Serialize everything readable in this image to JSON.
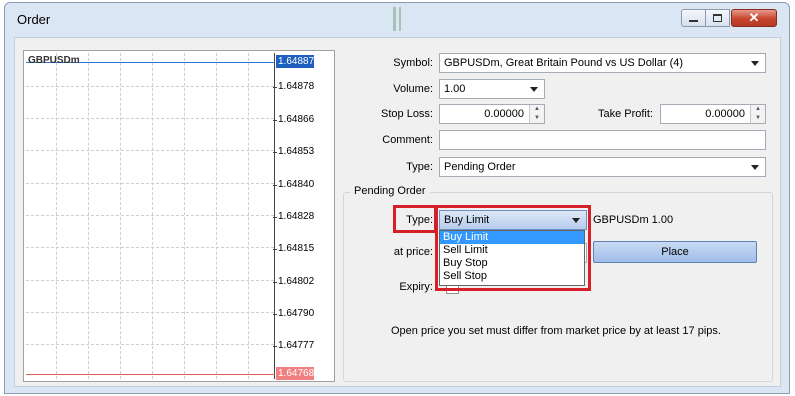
{
  "window": {
    "title": "Order",
    "close_glyph": "✕"
  },
  "chart": {
    "symbol": "GBPUSDm",
    "ask_price": "1.64887",
    "bid_price": "1.64768",
    "price_ticks": [
      "1.64878",
      "1.64866",
      "1.64853",
      "1.64840",
      "1.64828",
      "1.64815",
      "1.64802",
      "1.64790",
      "1.64777"
    ],
    "ask_color": "#1e5fbf",
    "bid_color": "#f08080"
  },
  "form": {
    "symbol_label": "Symbol:",
    "symbol_value": "GBPUSDm, Great Britain Pound vs US Dollar (4)",
    "volume_label": "Volume:",
    "volume_value": "1.00",
    "stop_loss_label": "Stop Loss:",
    "stop_loss_value": "0.00000",
    "take_profit_label": "Take Profit:",
    "take_profit_value": "0.00000",
    "comment_label": "Comment:",
    "comment_value": "",
    "type_label": "Type:",
    "type_value": "Pending Order"
  },
  "pending": {
    "group_title": "Pending Order",
    "type_label": "Type:",
    "type_value": "Buy Limit",
    "type_options": [
      "Buy Limit",
      "Sell Limit",
      "Buy Stop",
      "Sell Stop"
    ],
    "selected_option": "Buy Limit",
    "instrument_info": "GBPUSDm 1.00",
    "at_price_label": "at price:",
    "place_label": "Place",
    "expiry_label": "Expiry:",
    "note": "Open price you set must differ from market price by at least 17 pips.",
    "highlight_color": "#d5202a"
  }
}
